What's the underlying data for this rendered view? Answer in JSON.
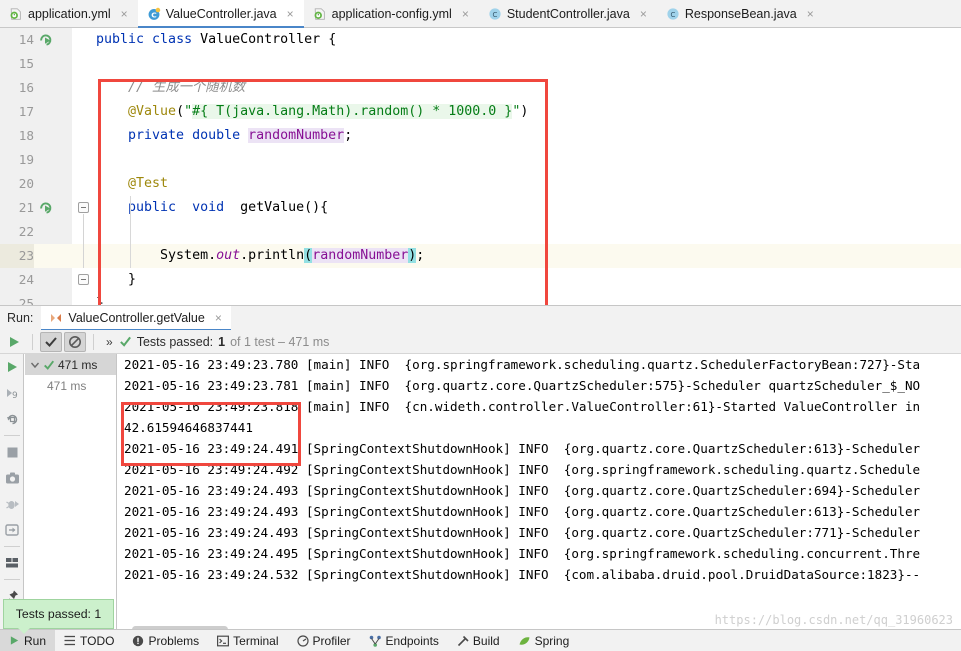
{
  "tabs": [
    {
      "label": "application.yml",
      "icon": "yml-file-icon",
      "active": false
    },
    {
      "label": "ValueController.java",
      "icon": "java-class-icon",
      "active": true
    },
    {
      "label": "application-config.yml",
      "icon": "yml-file-icon",
      "active": false
    },
    {
      "label": "StudentController.java",
      "icon": "java-class-icon",
      "active": false
    },
    {
      "label": "ResponseBean.java",
      "icon": "java-class-icon",
      "active": false
    }
  ],
  "editor": {
    "lines": [
      {
        "num": "14",
        "parts": [
          {
            "t": "public ",
            "c": "k"
          },
          {
            "t": "class ",
            "c": "k"
          },
          {
            "t": "ValueController ",
            "c": ""
          },
          {
            "t": "{",
            "c": ""
          }
        ],
        "gutter_run": true,
        "current": false
      },
      {
        "num": "15",
        "parts": [],
        "current": false
      },
      {
        "num": "16",
        "parts": [
          {
            "t": "    // 生成一个随机数",
            "c": "cm"
          }
        ],
        "current": false
      },
      {
        "num": "17",
        "parts": [
          {
            "t": "    @Value",
            "c": "an"
          },
          {
            "t": "(",
            "c": ""
          },
          {
            "t": "\"",
            "c": "st"
          },
          {
            "t": "#{ T(java.lang.Math).random() * 1000.0 }",
            "c": "spel-text"
          },
          {
            "t": "\"",
            "c": "st"
          },
          {
            "t": ")",
            "c": ""
          }
        ],
        "current": false
      },
      {
        "num": "18",
        "parts": [
          {
            "t": "    private ",
            "c": "k"
          },
          {
            "t": "double ",
            "c": "k"
          },
          {
            "t": "randomNumber",
            "c": "fldbg-text"
          },
          {
            "t": ";",
            "c": ""
          }
        ],
        "current": false
      },
      {
        "num": "19",
        "parts": [],
        "current": false
      },
      {
        "num": "20",
        "parts": [
          {
            "t": "    @Test",
            "c": "an"
          }
        ],
        "current": false
      },
      {
        "num": "21",
        "parts": [
          {
            "t": "    public ",
            "c": "k"
          },
          {
            "t": " void ",
            "c": "k"
          },
          {
            "t": " getValue(){",
            "c": ""
          }
        ],
        "gutter_run": true,
        "fold": true,
        "current": false
      },
      {
        "num": "22",
        "parts": [],
        "current": false
      },
      {
        "num": "23",
        "parts": [
          {
            "t": "        System.",
            "c": ""
          },
          {
            "t": "out",
            "c": "stf"
          },
          {
            "t": ".println",
            "c": ""
          },
          {
            "t": "(",
            "c": "brmatch-text"
          },
          {
            "t": "randomNumber",
            "c": "fldbg-text"
          },
          {
            "t": ")",
            "c": "brmatch-text"
          },
          {
            "t": ";",
            "c": ""
          }
        ],
        "current": true
      },
      {
        "num": "24",
        "parts": [
          {
            "t": "    }",
            "c": ""
          }
        ],
        "foldend": true,
        "current": false
      },
      {
        "num": "25",
        "parts": [
          {
            "t": "}",
            "c": ""
          }
        ],
        "current": false
      }
    ]
  },
  "run_panel": {
    "label": "Run:",
    "tab_label": "ValueController.getValue",
    "tab_close": "×",
    "expand_chevrons": "»",
    "status_prefix": "Tests passed:",
    "status_count": "1",
    "status_suffix": "of 1 test – 471 ms",
    "toolbar_icons": [
      "rerun-icon",
      "toggle-auto-test-icon",
      "filter-passed-icon"
    ],
    "side_icons": [
      "rerun-green-play-icon",
      "rerun-failed-icon",
      "restart-icon",
      "stop-icon",
      "screenshot-icon",
      "debug-icon",
      "export-icon",
      "layout-icon",
      "pin-icon"
    ],
    "tree": [
      {
        "label": "471 ms",
        "selected": true,
        "status": "passed",
        "sub": false
      },
      {
        "label": "471 ms",
        "selected": false,
        "status": "passed",
        "sub": true
      }
    ]
  },
  "console": {
    "lines": [
      "2021-05-16 23:49:23.780 [main] INFO  {org.springframework.scheduling.quartz.SchedulerFactoryBean:727}-Sta",
      "2021-05-16 23:49:23.781 [main] INFO  {org.quartz.core.QuartzScheduler:575}-Scheduler quartzScheduler_$_NO",
      "2021-05-16 23:49:23.818 [main] INFO  {cn.wideth.controller.ValueController:61}-Started ValueController in",
      "42.61594646837441",
      "2021-05-16 23:49:24.491 [SpringContextShutdownHook] INFO  {org.quartz.core.QuartzScheduler:613}-Scheduler",
      "2021-05-16 23:49:24.492 [SpringContextShutdownHook] INFO  {org.springframework.scheduling.quartz.Schedule",
      "2021-05-16 23:49:24.493 [SpringContextShutdownHook] INFO  {org.quartz.core.QuartzScheduler:694}-Scheduler",
      "2021-05-16 23:49:24.493 [SpringContextShutdownHook] INFO  {org.quartz.core.QuartzScheduler:613}-Scheduler",
      "2021-05-16 23:49:24.493 [SpringContextShutdownHook] INFO  {org.quartz.core.QuartzScheduler:771}-Scheduler",
      "2021-05-16 23:49:24.495 [SpringContextShutdownHook] INFO  {org.springframework.scheduling.concurrent.Thre",
      "2021-05-16 23:49:24.532 [SpringContextShutdownHook] INFO  {com.alibaba.druid.pool.DruidDataSource:1823}--"
    ]
  },
  "tooltip": {
    "text": "Tests passed: 1"
  },
  "status_bar": [
    {
      "label": "Run",
      "icon": "run-play-icon",
      "active": true
    },
    {
      "label": "TODO",
      "icon": "todo-list-icon",
      "active": false
    },
    {
      "label": "Problems",
      "icon": "problems-icon",
      "active": false
    },
    {
      "label": "Terminal",
      "icon": "terminal-icon",
      "active": false
    },
    {
      "label": "Profiler",
      "icon": "profiler-icon",
      "active": false
    },
    {
      "label": "Endpoints",
      "icon": "endpoints-icon",
      "active": false
    },
    {
      "label": "Build",
      "icon": "build-hammer-icon",
      "active": false
    },
    {
      "label": "Spring",
      "icon": "spring-leaf-icon",
      "active": false
    }
  ],
  "watermark": {
    "text": "https://blog.csdn.net/qq_31960623"
  },
  "colors": {
    "accent": "#4a86c8",
    "highlight_box": "#f0473e",
    "pass_green": "#59a869",
    "tooltip_bg": "#ccf0cc"
  }
}
